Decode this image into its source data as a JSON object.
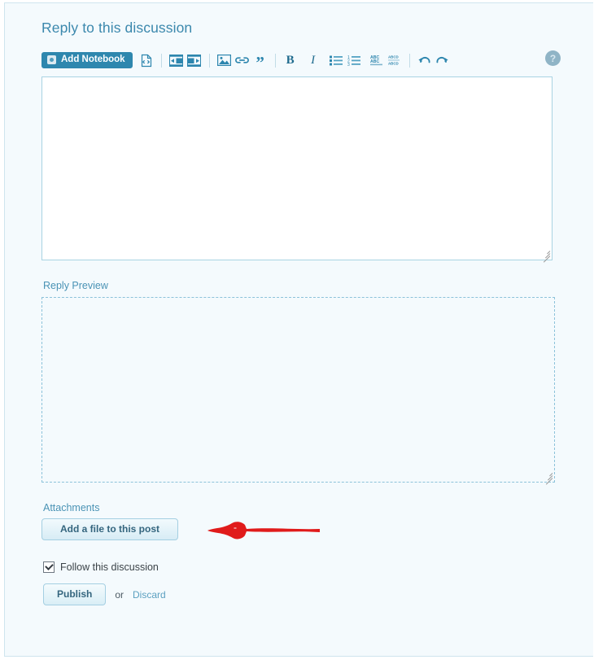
{
  "panel": {
    "heading": "Reply to this discussion",
    "bg_color": "#f4fafd",
    "border_color": "#cfe5ee"
  },
  "toolbar": {
    "add_notebook_label": "Add Notebook",
    "accent_color": "#2e87ae",
    "items": [
      {
        "name": "add-notebook-button",
        "label": "Add Notebook"
      },
      {
        "name": "source-code-icon",
        "label": "<>"
      },
      {
        "name": "indent-icon",
        "label": ""
      },
      {
        "name": "outdent-icon",
        "label": ""
      },
      {
        "name": "insert-image-icon",
        "label": ""
      },
      {
        "name": "insert-link-icon",
        "label": ""
      },
      {
        "name": "blockquote-icon",
        "label": "”"
      },
      {
        "name": "bold-icon",
        "label": "B"
      },
      {
        "name": "italic-icon",
        "label": "I"
      },
      {
        "name": "bullet-list-icon",
        "label": ""
      },
      {
        "name": "numbered-list-icon",
        "label": ""
      },
      {
        "name": "spellcheck-icon",
        "label": "ABC"
      },
      {
        "name": "remove-format-icon",
        "label": "ABCD"
      },
      {
        "name": "undo-icon",
        "label": ""
      },
      {
        "name": "redo-icon",
        "label": ""
      }
    ],
    "help_label": "?"
  },
  "editor": {
    "value": "",
    "placeholder": ""
  },
  "preview": {
    "label": "Reply Preview",
    "content": ""
  },
  "attachments": {
    "label": "Attachments",
    "add_file_label": "Add a file to this post"
  },
  "annotation": {
    "arrow_color": "#e01b1b",
    "direction": "left"
  },
  "follow": {
    "label": "Follow this discussion",
    "checked": true
  },
  "actions": {
    "publish_label": "Publish",
    "or_label": "or",
    "discard_label": "Discard"
  }
}
